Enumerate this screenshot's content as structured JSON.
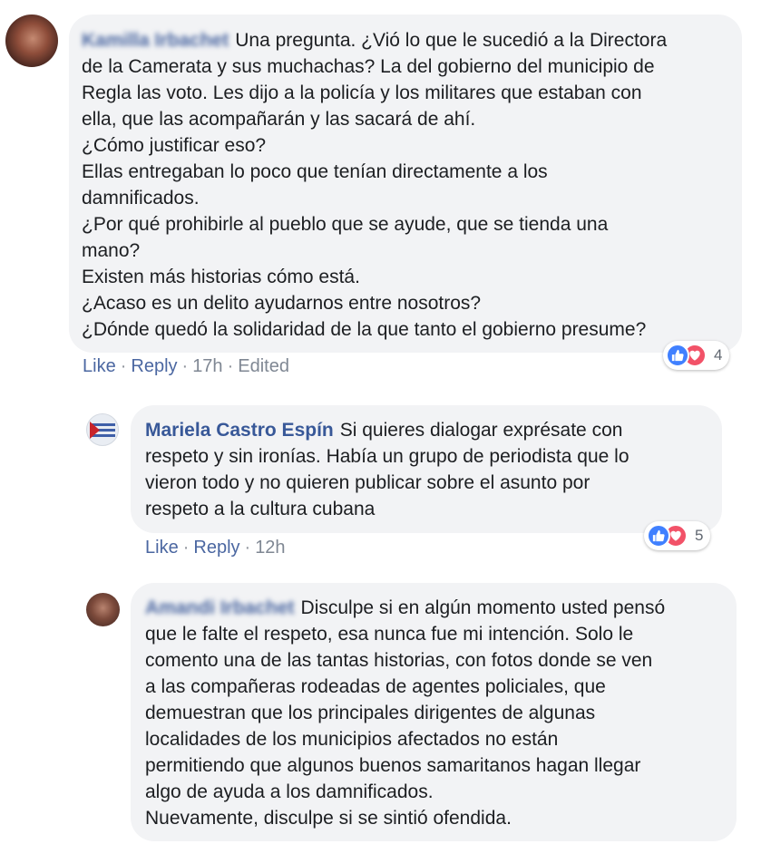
{
  "comments": [
    {
      "author": "Kamilla Irbachet",
      "lines": [
        "Una pregunta. ¿Vió lo que le sucedió a la Directora",
        "de la Camerata y sus muchachas? La del gobierno del municipio de",
        "Regla las voto. Les dijo a la policía y los militares que estaban con",
        "ella, que las acompañarán y las sacará de ahí.",
        "¿Cómo justificar eso?",
        "Ellas entregaban lo poco que tenían directamente a los",
        "damnificados.",
        "¿Por qué prohibirle al pueblo que se ayude, que se tienda una",
        "mano?",
        "Existen más historias cómo está.",
        "¿Acaso es un delito ayudarnos entre nosotros?",
        "¿Dónde quedó la solidaridad de la que tanto el gobierno presume?"
      ],
      "actions": {
        "like": "Like",
        "reply": "Reply",
        "time": "17h",
        "edited": "Edited"
      },
      "reaction_count": "4"
    },
    {
      "author": "Mariela Castro Espín",
      "lines": [
        "Si quieres dialogar exprésate con",
        "respeto y sin ironías. Había un grupo de periodista que lo",
        "vieron todo y no quieren publicar sobre el asunto por",
        "respeto a la cultura cubana"
      ],
      "actions": {
        "like": "Like",
        "reply": "Reply",
        "time": "12h"
      },
      "reaction_count": "5"
    },
    {
      "author": "Amandi Irbachet",
      "lines": [
        "Disculpe si en algún momento usted pensó",
        "que le falte el respeto, esa nunca fue mi intención. Solo le",
        "comento una de las tantas historias, con fotos donde se ven",
        "a las compañeras rodeadas de agentes policiales, que",
        "demuestran que los principales dirigentes de algunas",
        "localidades de los municipios afectados no están",
        "permitiendo que algunos buenos samaritanos hagan llegar",
        "algo de ayuda a los damnificados.",
        "Nuevamente, disculpe si se sintió ofendida."
      ]
    }
  ],
  "separator": "·",
  "colors": {
    "link": "#385898",
    "bubble": "#f2f3f5",
    "like": "#4080ff",
    "love": "#f25268"
  },
  "icons": {
    "like": "thumbs-up-icon",
    "love": "heart-icon"
  }
}
